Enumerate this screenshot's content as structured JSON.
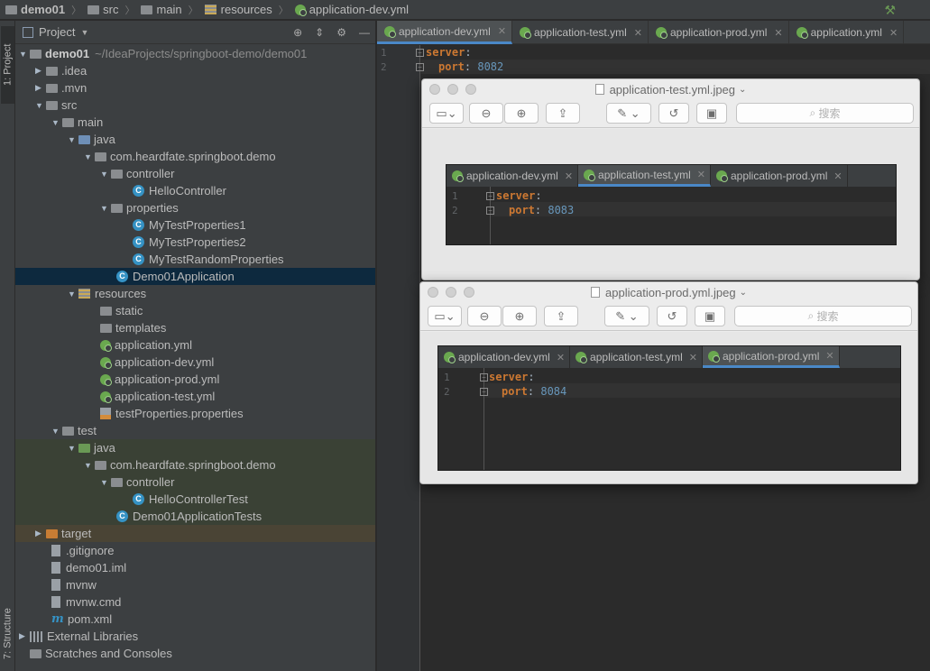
{
  "breadcrumb": {
    "items": [
      "demo01",
      "src",
      "main",
      "resources",
      "application-dev.yml"
    ]
  },
  "toolstrip": {
    "project_tab": "1: Project",
    "structure_tab": "7: Structure"
  },
  "project_panel": {
    "title": "Project",
    "tree": [
      {
        "label": "demo01",
        "path": "~/IdeaProjects/springboot-demo/demo01"
      },
      {
        "label": ".idea"
      },
      {
        "label": ".mvn"
      },
      {
        "label": "src"
      },
      {
        "label": "main"
      },
      {
        "label": "java"
      },
      {
        "label": "com.heardfate.springboot.demo"
      },
      {
        "label": "controller"
      },
      {
        "label": "HelloController"
      },
      {
        "label": "properties"
      },
      {
        "label": "MyTestProperties1"
      },
      {
        "label": "MyTestProperties2"
      },
      {
        "label": "MyTestRandomProperties"
      },
      {
        "label": "Demo01Application"
      },
      {
        "label": "resources"
      },
      {
        "label": "static"
      },
      {
        "label": "templates"
      },
      {
        "label": "application.yml"
      },
      {
        "label": "application-dev.yml"
      },
      {
        "label": "application-prod.yml"
      },
      {
        "label": "application-test.yml"
      },
      {
        "label": "testProperties.properties"
      },
      {
        "label": "test"
      },
      {
        "label": "java"
      },
      {
        "label": "com.heardfate.springboot.demo"
      },
      {
        "label": "controller"
      },
      {
        "label": "HelloControllerTest"
      },
      {
        "label": "Demo01ApplicationTests"
      },
      {
        "label": "target"
      },
      {
        "label": ".gitignore"
      },
      {
        "label": "demo01.iml"
      },
      {
        "label": "mvnw"
      },
      {
        "label": "mvnw.cmd"
      },
      {
        "label": "pom.xml"
      },
      {
        "label": "External Libraries"
      },
      {
        "label": "Scratches and Consoles"
      }
    ]
  },
  "editor": {
    "tabs": [
      "application-dev.yml",
      "application-test.yml",
      "application-prod.yml",
      "application.yml"
    ],
    "active_tab": 0,
    "lines": [
      {
        "num": "1",
        "key": "server",
        "value": ""
      },
      {
        "num": "2",
        "key": "port",
        "value": "8082"
      }
    ]
  },
  "preview_test": {
    "title": "application-test.yml.jpeg",
    "search_placeholder": "搜索",
    "tabs": [
      "application-dev.yml",
      "application-test.yml",
      "application-prod.yml"
    ],
    "active_tab": 1,
    "lines": [
      {
        "num": "1",
        "key": "server",
        "value": ""
      },
      {
        "num": "2",
        "key": "port",
        "value": "8083"
      }
    ]
  },
  "preview_prod": {
    "title": "application-prod.yml.jpeg",
    "search_placeholder": "搜索",
    "tabs": [
      "application-dev.yml",
      "application-test.yml",
      "application-prod.yml"
    ],
    "active_tab": 2,
    "lines": [
      {
        "num": "1",
        "key": "server",
        "value": ""
      },
      {
        "num": "2",
        "key": "port",
        "value": "8084"
      }
    ]
  }
}
